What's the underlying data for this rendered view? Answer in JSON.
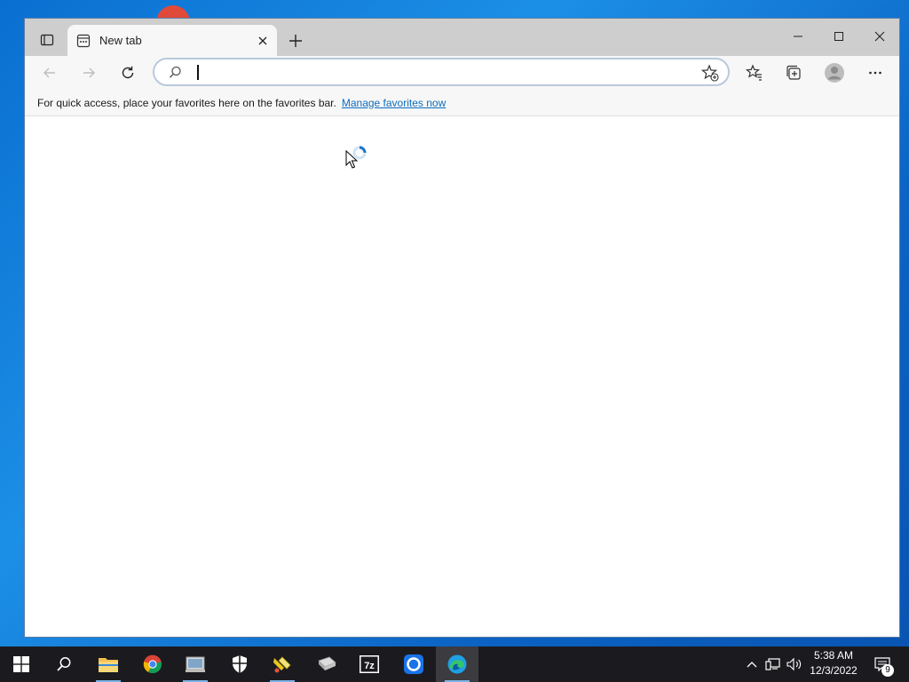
{
  "browser": {
    "tab": {
      "title": "New tab"
    },
    "address_bar": {
      "value": "",
      "placeholder": ""
    },
    "favorites_bar": {
      "message": "For quick access, place your favorites here on the favorites bar.",
      "link_label": "Manage favorites now"
    }
  },
  "taskbar": {
    "pinned_icons": [
      "start-icon",
      "search-icon",
      "file-explorer-icon",
      "chrome-icon",
      "network-app-icon",
      "security-shield-icon",
      "paint-tool-icon",
      "disk-drive-app-icon",
      "7zip-icon",
      "app-circle-icon",
      "edge-icon"
    ],
    "clock": {
      "time": "5:38 AM",
      "date": "12/3/2022"
    },
    "notification_count": "9"
  },
  "colors": {
    "accent": "#0f6cbd",
    "taskbar": "#1b1b1f",
    "titlebar": "#cecece"
  }
}
